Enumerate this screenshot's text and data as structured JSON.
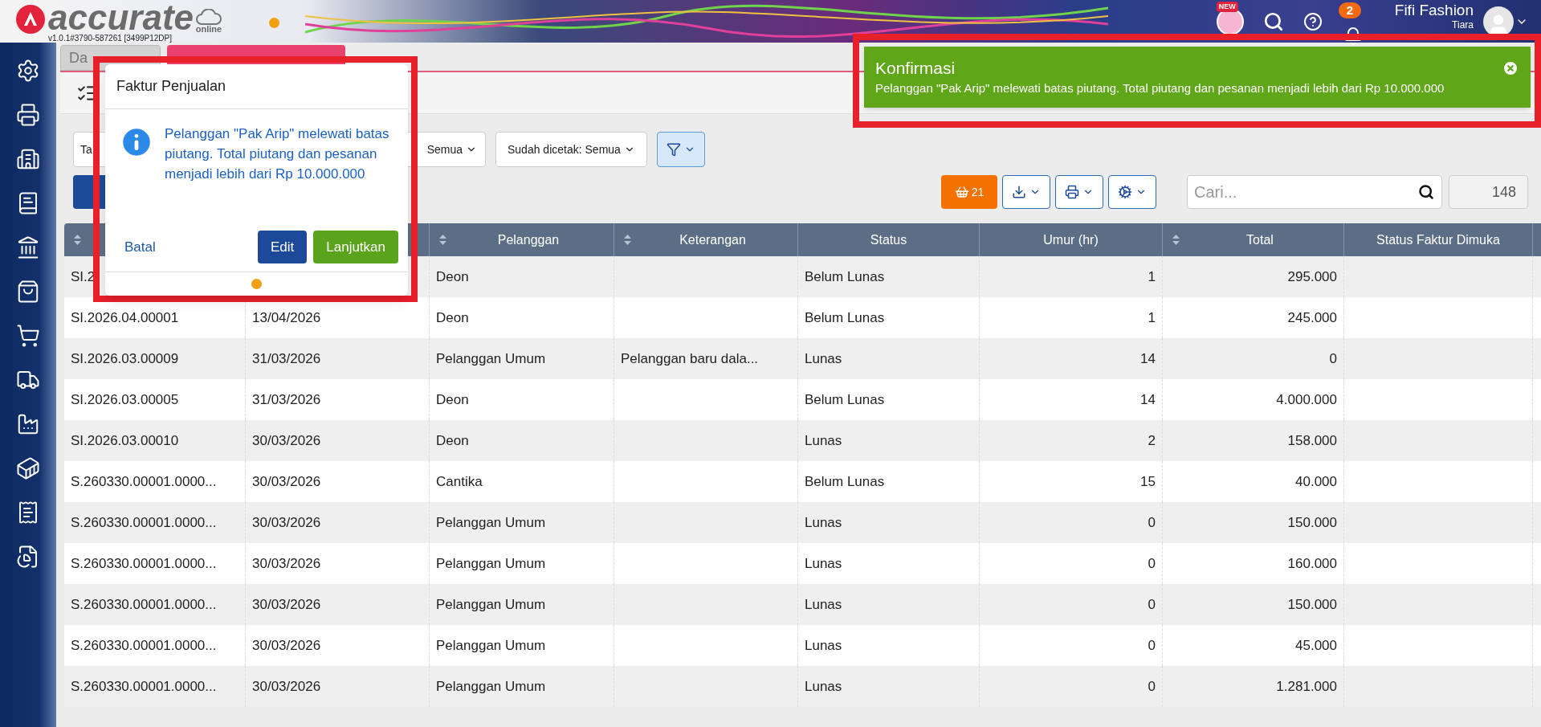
{
  "header": {
    "logo_text": "accurate",
    "logo_subtext": "online",
    "version": "v1.0.1#3790-587261 [3499P12DP]",
    "new_badge": "NEW",
    "notification_count": "2",
    "company": "Fifi Fashion",
    "user": "Tiara"
  },
  "tabs": [
    {
      "label": "Da",
      "selected": false
    },
    {
      "selected": true
    }
  ],
  "filters": [
    {
      "label": "Ta"
    },
    {
      "label": "Semua"
    },
    {
      "label": "Sudah dicetak: Semua"
    }
  ],
  "toolbar": {
    "basket_count": "21",
    "search": {
      "placeholder": "Cari..."
    },
    "record_count": "148"
  },
  "table": {
    "columns": [
      {
        "sortable": true
      },
      {},
      {
        "label": "Pelanggan",
        "sortable": true
      },
      {
        "label": "Keterangan",
        "sortable": true
      },
      {
        "label": "Status",
        "sortable": false
      },
      {
        "label": "Umur (hr)",
        "sortable": false
      },
      {
        "label": "Total",
        "sortable": true
      },
      {
        "label": "Status Faktur Dimuka",
        "sortable": false
      }
    ],
    "rows": [
      {
        "number": "SI.2",
        "customer": "Deon",
        "status": "Belum Lunas",
        "age": "1",
        "total": "295.000"
      },
      {
        "number": "SI.2026.04.00001",
        "date": "13/04/2026",
        "customer": "Deon",
        "status": "Belum Lunas",
        "age": "1",
        "total": "245.000"
      },
      {
        "number": "SI.2026.03.00009",
        "date": "31/03/2026",
        "customer": "Pelanggan Umum",
        "note": "Pelanggan baru dala...",
        "status": "Lunas",
        "age": "14",
        "total": "0"
      },
      {
        "number": "SI.2026.03.00005",
        "date": "31/03/2026",
        "customer": "Deon",
        "status": "Belum Lunas",
        "age": "14",
        "total": "4.000.000"
      },
      {
        "number": "SI.2026.03.00010",
        "date": "30/03/2026",
        "customer": "Deon",
        "status": "Lunas",
        "age": "2",
        "total": "158.000"
      },
      {
        "number": "S.260330.00001.0000...",
        "date": "30/03/2026",
        "customer": "Cantika",
        "status": "Belum Lunas",
        "age": "15",
        "total": "40.000"
      },
      {
        "number": "S.260330.00001.0000...",
        "date": "30/03/2026",
        "customer": "Pelanggan Umum",
        "status": "Lunas",
        "age": "0",
        "total": "150.000"
      },
      {
        "number": "S.260330.00001.0000...",
        "date": "30/03/2026",
        "customer": "Pelanggan Umum",
        "status": "Lunas",
        "age": "0",
        "total": "160.000"
      },
      {
        "number": "S.260330.00001.0000...",
        "date": "30/03/2026",
        "customer": "Pelanggan Umum",
        "status": "Lunas",
        "age": "0",
        "total": "150.000"
      },
      {
        "number": "S.260330.00001.0000...",
        "date": "30/03/2026",
        "customer": "Pelanggan Umum",
        "status": "Lunas",
        "age": "0",
        "total": "45.000"
      },
      {
        "number": "S.260330.00001.0000...",
        "date": "30/03/2026",
        "customer": "Pelanggan Umum",
        "status": "Lunas",
        "age": "0",
        "total": "1.281.000"
      }
    ]
  },
  "dialog": {
    "title": "Faktur Penjualan",
    "message": "Pelanggan \"Pak Arip\" melewati batas piutang. Total piutang dan pesanan menjadi lebih dari Rp 10.000.000",
    "buttons": [
      {
        "label": "Batal",
        "kind": "link"
      },
      {
        "label": "Edit",
        "kind": "primary"
      },
      {
        "label": "Lanjutkan",
        "kind": "success"
      }
    ]
  },
  "toast": {
    "title": "Konfirmasi",
    "message": "Pelanggan \"Pak Arip\" melewati batas piutang. Total piutang dan pesanan menjadi lebih dari Rp 10.000.000"
  }
}
